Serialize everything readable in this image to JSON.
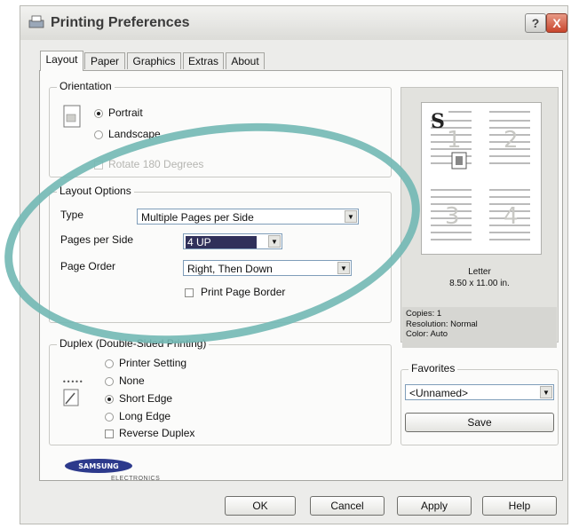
{
  "window": {
    "title": "Printing Preferences",
    "help_label": "?",
    "close_label": "X"
  },
  "tabs": [
    "Layout",
    "Paper",
    "Graphics",
    "Extras",
    "About"
  ],
  "orientation": {
    "legend": "Orientation",
    "portrait_label": "Portrait",
    "landscape_label": "Landscape",
    "rotate_label": "Rotate 180 Degrees",
    "selected": "Portrait"
  },
  "layout_options": {
    "legend": "Layout Options",
    "type_label": "Type",
    "type_value": "Multiple Pages per Side",
    "pages_per_side_label": "Pages per Side",
    "pages_per_side_value": "4 UP",
    "page_order_label": "Page Order",
    "page_order_value": "Right, Then Down",
    "print_border_label": "Print Page Border"
  },
  "duplex": {
    "legend": "Duplex (Double-Sided Printing)",
    "options": [
      "Printer Setting",
      "None",
      "Short Edge",
      "Long Edge"
    ],
    "selected": "Short Edge",
    "reverse_label": "Reverse Duplex"
  },
  "preview": {
    "page_numbers": [
      "1",
      "2",
      "3",
      "4"
    ],
    "logo_glyph": "S",
    "paper_name": "Letter",
    "paper_size": "8.50 x 11.00 in.",
    "info": [
      "Copies: 1",
      "Resolution: Normal",
      "Color: Auto"
    ]
  },
  "favorites": {
    "legend": "Favorites",
    "value": "<Unnamed>",
    "save_label": "Save"
  },
  "brand": {
    "name": "SAMSUNG",
    "sub": "ELECTRONICS",
    "color": "#2d3a8c"
  },
  "buttons": {
    "ok": "OK",
    "cancel": "Cancel",
    "apply": "Apply",
    "help": "Help"
  },
  "annotation_color": "#72b8b4"
}
